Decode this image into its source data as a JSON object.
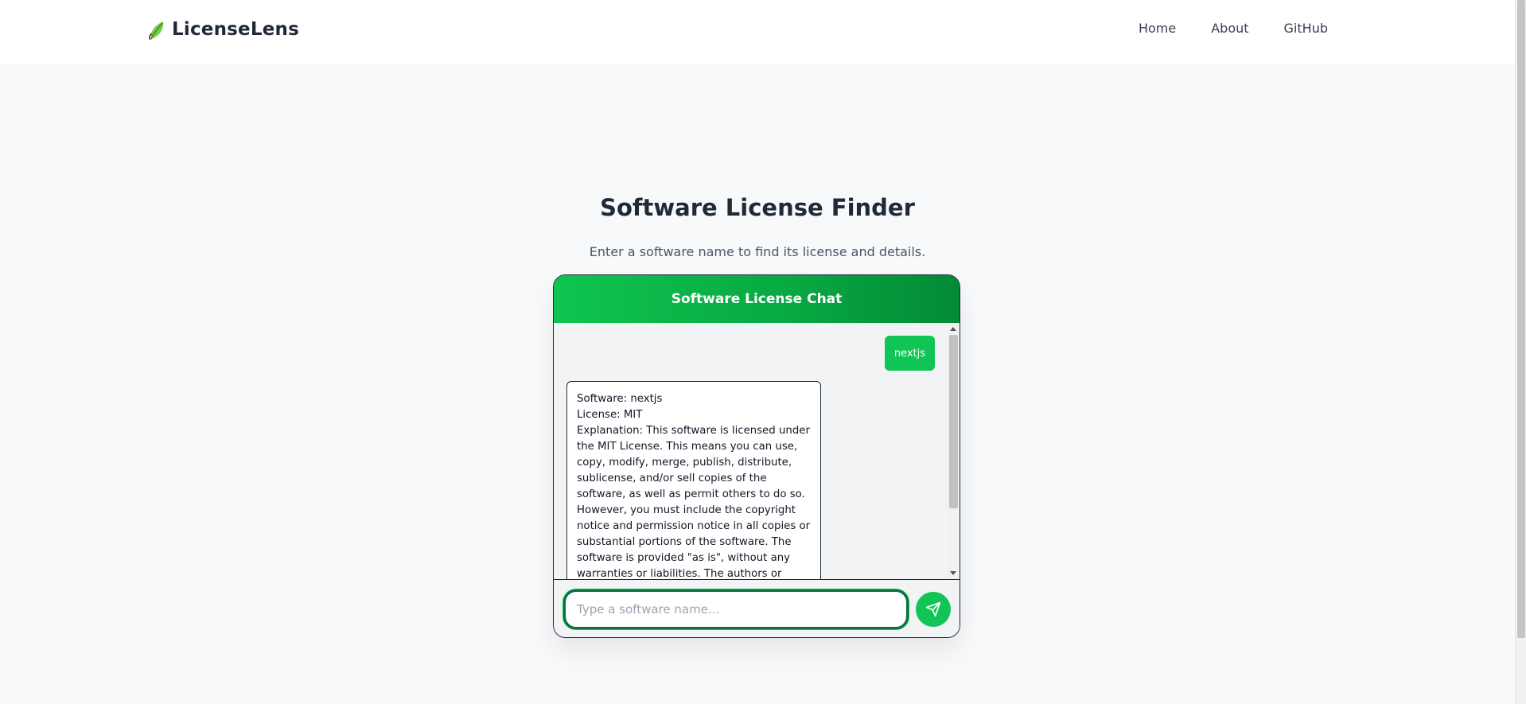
{
  "header": {
    "brand": "LicenseLens",
    "brand_icon": "leaf-icon",
    "nav": [
      {
        "label": "Home"
      },
      {
        "label": "About"
      },
      {
        "label": "GitHub"
      }
    ]
  },
  "hero": {
    "title": "Software License Finder",
    "subtitle": "Enter a software name to find its license and details."
  },
  "chat": {
    "title": "Software License Chat",
    "user_message": "nextjs",
    "bot_lines": [
      "Software: nextjs",
      "License: MIT",
      "Explanation: This software is licensed under the MIT License. This means you can use, copy, modify, merge, publish, distribute, sublicense, and/or sell copies of the software, as well as permit others to do so. However, you must include the copyright notice and permission notice in all copies or substantial portions of the software. The software is provided \"as is\", without any warranties or liabilities. The authors or copyright holders are not"
    ],
    "input_placeholder": "Type a software name...",
    "input_value": "",
    "send_icon": "send-icon"
  },
  "colors": {
    "accent": "#10c556",
    "accent_dark": "#028a35",
    "text": "#1f2937"
  }
}
